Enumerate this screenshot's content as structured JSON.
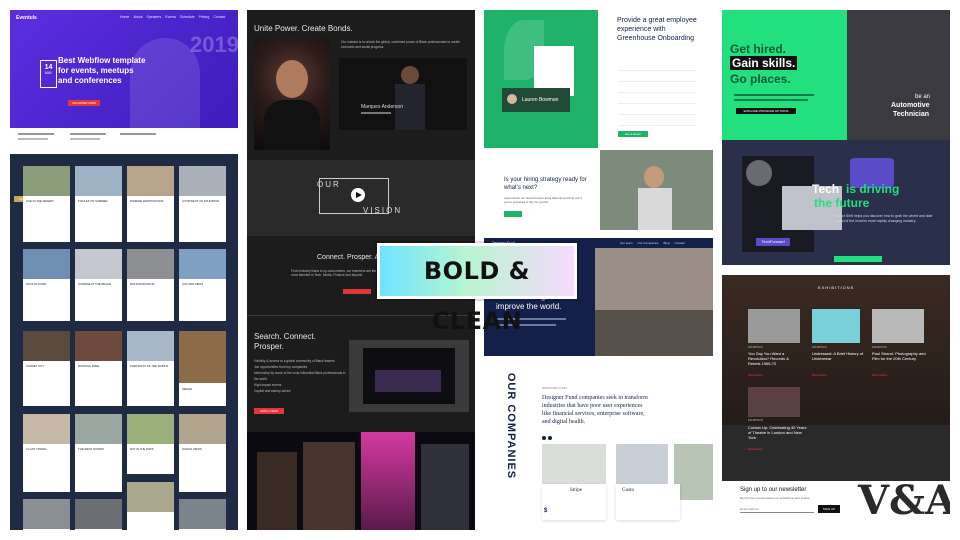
{
  "badge": {
    "label": "BOLD & CLEAN"
  },
  "events": {
    "logo": "Eventuls",
    "nav": [
      "Home",
      "About",
      "Speakers",
      "Events",
      "Schedule",
      "Pricing",
      "Contact"
    ],
    "year": "2019",
    "date_day": "14",
    "date_month": "MAY",
    "title_line1": "Best Webflow template",
    "title_line2": "for events, meetups",
    "title_line3": "and conferences",
    "cta": "REGISTER NOW"
  },
  "blog": {
    "featured_tag": "Featured",
    "captions": [
      "LIFE IN THE DESERT",
      "5 RULES OF SUMMER",
      "DIVERSE DESTINATIONS",
      "A PORTRAIT OF ETHIOPIAN",
      "DAYS IN TOWN",
      "SUNRISE AT THE BEACH",
      "MOUNTAIN PATHS",
      "AUTUMN HIKES",
      "SUNSET CITY",
      "RUNNING FREE",
      "PORTRAITS OF THE WORLD",
      "SMILES",
      "A LAST TRAVEL",
      "THE WEST WOODS",
      "DAY IN THE PARK",
      "OCEAN VIEWS"
    ]
  },
  "unite": {
    "headline": "Unite Power. Create Bonds.",
    "mission": "Our mission is to unlock the global, combined power of Black professionals to create economic and social progress.",
    "person_name": "Marques Anderson",
    "our": "OUR",
    "vision": "VISION",
    "connect": "Connect. Prosper. As",
    "connect_body": "From industry titans to up-and-comers, our members are the most talented in Tech, Media, Finance and beyond.",
    "search_title": "Search. Connect.",
    "search_title2": "Prosper.",
    "bullets": [
      "Visibility & access to a global community of Black leaders",
      "Job opportunities from top companies",
      "Mentorship by some of the most influential Black professionals in the world",
      "High-impact events",
      "Capital and startup advice"
    ],
    "button": "APPLY NOW"
  },
  "greenhouse": {
    "headline": "Provide a great employee experience with Greenhouse Onboarding",
    "profile_name": "Lauren Bowman",
    "cta": "Get a Demo",
    "question": "Is your hiring strategy ready for what's next?",
    "body": "Learn about our Greenhouse Hiring Maturity and find out if you're prepared to hire for growth."
  },
  "designer": {
    "logo": "Designer Fund",
    "nav": [
      "Our team",
      "Our Companies",
      "Blog",
      "Contact"
    ],
    "headline": "then we design to improve the world.",
    "vertical": "OUR COMPANIES",
    "label": "DESIGNER FUND",
    "body": "Designer Fund companies seek to transform industries that have poor user experiences like financial services, enterprise software, and digital health.",
    "company1": "Stripe",
    "company2": "Gusto"
  },
  "tech": {
    "hero1": "Get hired.",
    "hero2": "Gain skills.",
    "hero3": "Go places.",
    "badge1": "be an",
    "badge2": "Automotive",
    "badge3": "Technician",
    "title1": "Tech",
    "title2": "is driving",
    "title3": "the future",
    "body": "Project Shift helps you discover how to grab the wheel and take control of the modern most rapidly changing industry.",
    "logo": "TechForward",
    "cta": "EXPLORE PROGRAM OPTIONS"
  },
  "exhibitions": {
    "heading": "EXHIBITIONS",
    "items": [
      {
        "tag": "EXHIBITION",
        "title": "You Say You Want a Revolution? Records & Rebels 1966-70"
      },
      {
        "tag": "EXHIBITION",
        "title": "Undressed: A Brief History of Underwear"
      },
      {
        "tag": "EXHIBITION",
        "title": "Paul Strand: Photography and Film for the 20th Century"
      },
      {
        "tag": "EXHIBITION",
        "title": "Curtain Up: Celebrating 40 Years of Theatre in London and New York"
      }
    ],
    "book": "Book tickets",
    "newsletter": "Sign up to our newsletter",
    "newsletter_body": "Be the first to know about our exhibitions and events",
    "email_placeholder": "Email address",
    "signup": "SIGN UP",
    "logo": "V&A"
  },
  "colors": {
    "purple": "#5b2fe0",
    "green": "#1fb36a",
    "mint": "#22e07e",
    "navy": "#12204a",
    "dark": "#1c1c1c",
    "red": "#e0383a"
  }
}
